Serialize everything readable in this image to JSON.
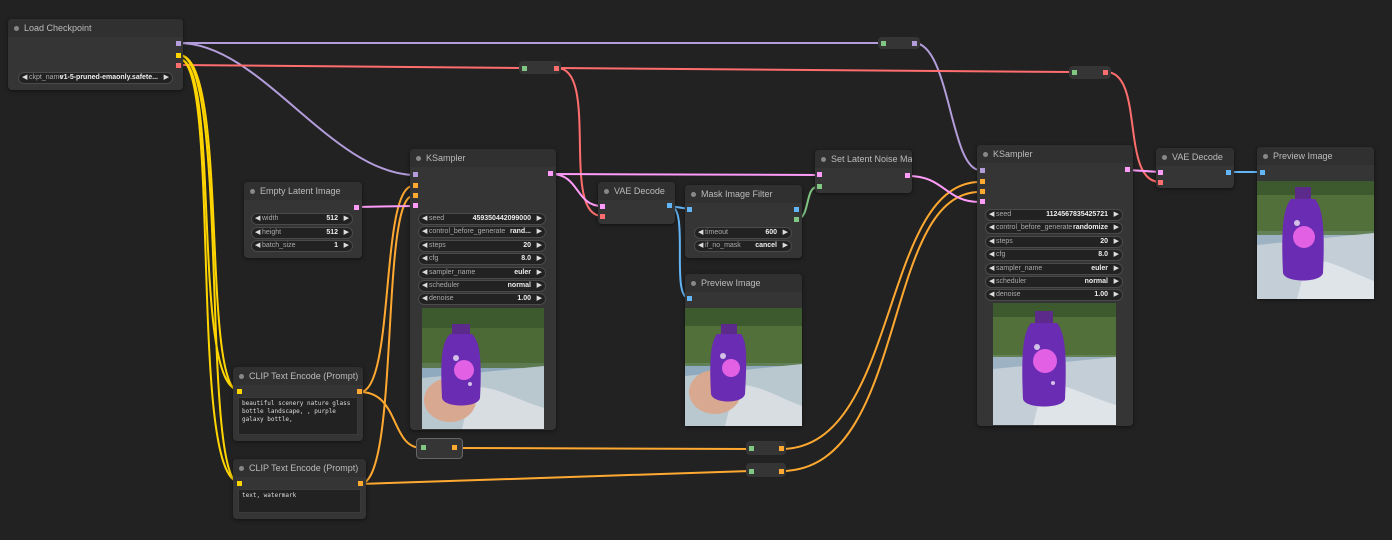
{
  "colors": {
    "background": "#222222",
    "model": "#b39ddb",
    "clip": "#ffd500",
    "vae": "#ff6e6e",
    "conditioning": "#ffa931",
    "latent": "#ff9cf9",
    "image": "#64b5f6",
    "mask": "#81c784"
  },
  "nodes": {
    "load_checkpoint": {
      "title": "Load Checkpoint",
      "ckpt_label": "ckpt_name",
      "ckpt_value": "v1-5-pruned-emaonly.safete..."
    },
    "empty_latent": {
      "title": "Empty Latent Image",
      "widgets": [
        {
          "label": "width",
          "value": "512"
        },
        {
          "label": "height",
          "value": "512"
        },
        {
          "label": "batch_size",
          "value": "1"
        }
      ]
    },
    "clip_pos": {
      "title": "CLIP Text Encode (Prompt)",
      "text": "beautiful scenery nature glass bottle landscape, , purple galaxy bottle,"
    },
    "clip_neg": {
      "title": "CLIP Text Encode (Prompt)",
      "text": "text, watermark"
    },
    "ksampler1": {
      "title": "KSampler",
      "widgets": [
        {
          "label": "seed",
          "value": "459350442099000"
        },
        {
          "label": "control_before_generate",
          "value": "rand..."
        },
        {
          "label": "steps",
          "value": "20"
        },
        {
          "label": "cfg",
          "value": "8.0"
        },
        {
          "label": "sampler_name",
          "value": "euler"
        },
        {
          "label": "scheduler",
          "value": "normal"
        },
        {
          "label": "denoise",
          "value": "1.00"
        }
      ]
    },
    "vae_decode1": {
      "title": "VAE Decode"
    },
    "mask_filter": {
      "title": "Mask Image Filter",
      "widgets": [
        {
          "label": "timeout",
          "value": "600"
        },
        {
          "label": "if_no_mask",
          "value": "cancel"
        }
      ]
    },
    "preview1": {
      "title": "Preview Image"
    },
    "set_latent_mask": {
      "title": "Set Latent Noise Mask"
    },
    "ksampler2": {
      "title": "KSampler",
      "widgets": [
        {
          "label": "seed",
          "value": "1124567835425721"
        },
        {
          "label": "control_before_generate",
          "value": "randomize"
        },
        {
          "label": "steps",
          "value": "20"
        },
        {
          "label": "cfg",
          "value": "8.0"
        },
        {
          "label": "sampler_name",
          "value": "euler"
        },
        {
          "label": "scheduler",
          "value": "normal"
        },
        {
          "label": "denoise",
          "value": "1.00"
        }
      ]
    },
    "vae_decode2": {
      "title": "VAE Decode"
    },
    "preview2": {
      "title": "Preview Image"
    }
  },
  "icons": {
    "arrow_left": "◀",
    "arrow_right": "▶"
  }
}
